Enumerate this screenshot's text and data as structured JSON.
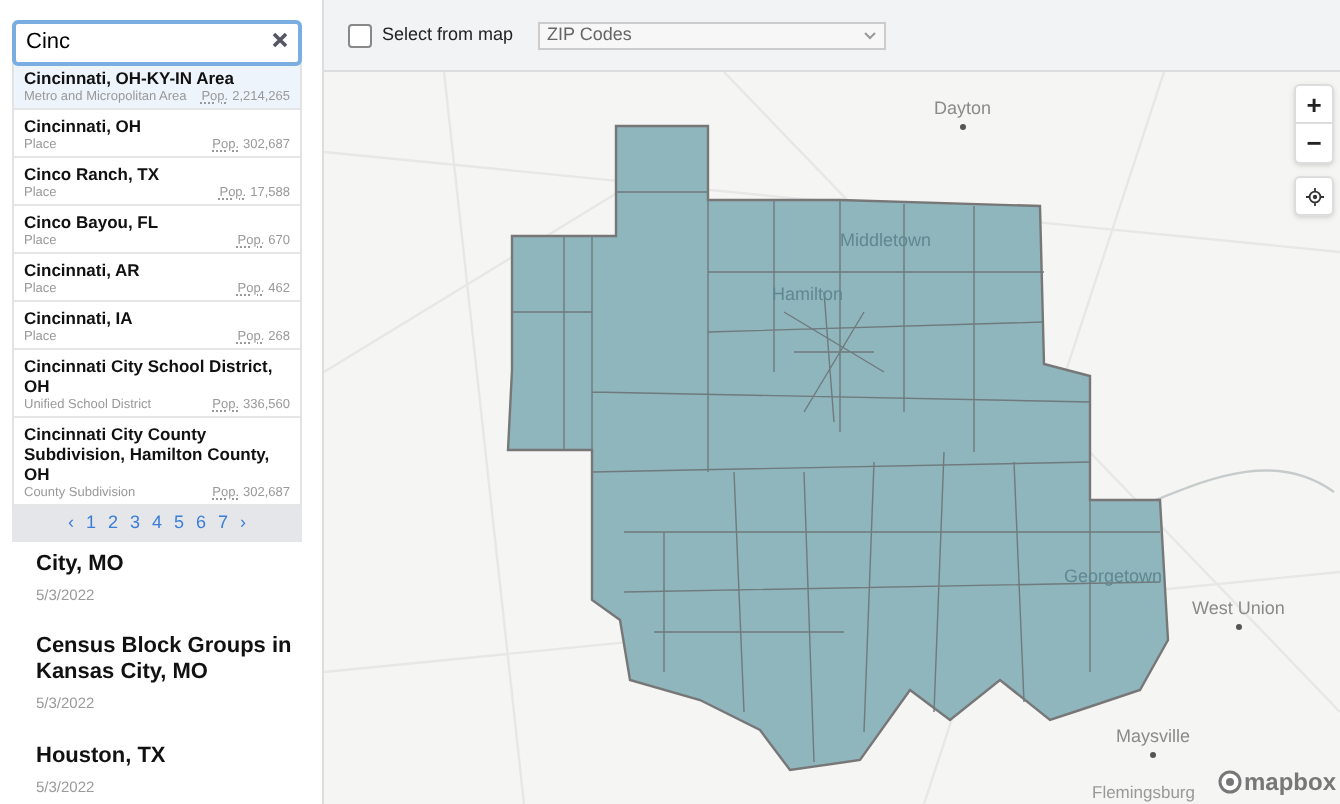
{
  "search": {
    "value": "Cinc"
  },
  "results": [
    {
      "name": "Cincinnati, OH-KY-IN Area",
      "type": "Metro and Micropolitan Area",
      "pop_label": "Pop.",
      "population": "2,214,265",
      "selected": true
    },
    {
      "name": "Cincinnati, OH",
      "type": "Place",
      "pop_label": "Pop.",
      "population": "302,687",
      "selected": false
    },
    {
      "name": "Cinco Ranch, TX",
      "type": "Place",
      "pop_label": "Pop.",
      "population": "17,588",
      "selected": false
    },
    {
      "name": "Cinco Bayou, FL",
      "type": "Place",
      "pop_label": "Pop.",
      "population": "670",
      "selected": false
    },
    {
      "name": "Cincinnati, AR",
      "type": "Place",
      "pop_label": "Pop.",
      "population": "462",
      "selected": false
    },
    {
      "name": "Cincinnati, IA",
      "type": "Place",
      "pop_label": "Pop.",
      "population": "268",
      "selected": false
    },
    {
      "name": "Cincinnati City School District, OH",
      "type": "Unified School District",
      "pop_label": "Pop.",
      "population": "336,560",
      "selected": false
    },
    {
      "name": "Cincinnati City County Subdivision, Hamilton County, OH",
      "type": "County Subdivision",
      "pop_label": "Pop.",
      "population": "302,687",
      "selected": false
    }
  ],
  "pagination": {
    "prev": "‹",
    "pages": [
      "1",
      "2",
      "3",
      "4",
      "5",
      "6",
      "7"
    ],
    "next": "›"
  },
  "saved_maps": [
    {
      "title": "City, MO",
      "date": "5/3/2022"
    },
    {
      "title": "Census Block Groups in Kansas City, MO",
      "date": "5/3/2022"
    },
    {
      "title": "Houston, TX",
      "date": "5/3/2022"
    }
  ],
  "toolbar": {
    "select_from_map": {
      "label": "Select from map",
      "checked": false
    },
    "geography": {
      "value": "ZIP Codes"
    }
  },
  "map": {
    "labels": [
      {
        "text": "Dayton",
        "kind": "city"
      },
      {
        "text": "Middletown",
        "kind": "covered"
      },
      {
        "text": "Hamilton",
        "kind": "covered"
      },
      {
        "text": "Georgetown",
        "kind": "covered"
      },
      {
        "text": "West Union",
        "kind": "city"
      },
      {
        "text": "Maysville",
        "kind": "city"
      },
      {
        "text": "Flemingsburg",
        "kind": "town"
      }
    ],
    "zoom_in": "+",
    "zoom_out": "−",
    "attribution": "mapbox"
  }
}
